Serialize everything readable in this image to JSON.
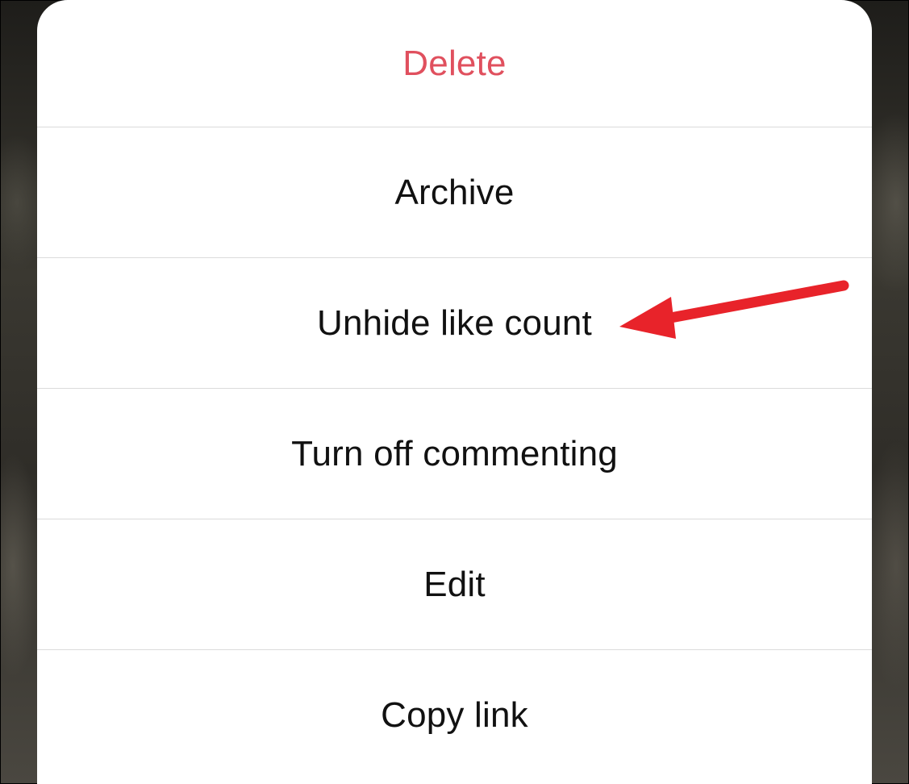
{
  "action_sheet": {
    "items": [
      {
        "label": "Delete",
        "style": "destructive"
      },
      {
        "label": "Archive",
        "style": "default"
      },
      {
        "label": "Unhide like count",
        "style": "default"
      },
      {
        "label": "Turn off commenting",
        "style": "default"
      },
      {
        "label": "Edit",
        "style": "default"
      },
      {
        "label": "Copy link",
        "style": "default"
      }
    ]
  },
  "colors": {
    "destructive": "#e0505e",
    "text": "#111111",
    "divider": "#dbdbdb",
    "sheet_background": "#ffffff",
    "annotation_arrow": "#e8232a"
  },
  "annotation": {
    "icon": "red-arrow-icon",
    "points_to": "Unhide like count"
  }
}
